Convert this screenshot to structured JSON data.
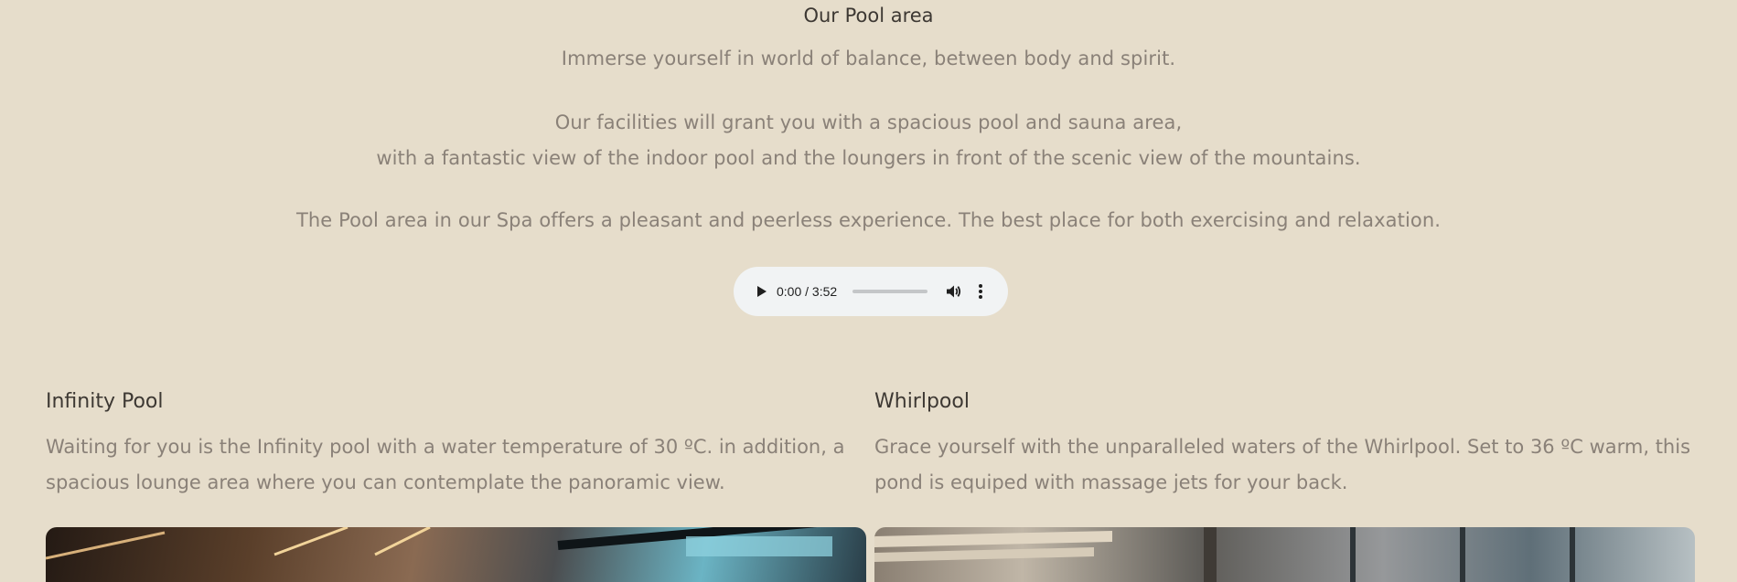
{
  "intro": {
    "title": "Our Pool area",
    "paragraph_1": "Immerse yourself in world of balance, between body and spirit.",
    "paragraph_2_line_1": "Our facilities will grant you with a spacious pool and sauna area,",
    "paragraph_2_line_2": "with a fantastic view of the indoor pool and the loungers in front of the scenic view of the mountains.",
    "paragraph_3": "The Pool area in our Spa offers a pleasant and peerless experience. The best place for both exercising and relaxation."
  },
  "audio": {
    "current_time": "0:00",
    "duration": "3:52",
    "time_label": "0:00 / 3:52",
    "progress": 0,
    "icons": {
      "play": "play-icon",
      "volume": "volume-icon",
      "more": "more-options-icon"
    }
  },
  "sections": [
    {
      "title": "Infinity Pool",
      "description": "Waiting for you is the Infinity pool with a water temperature of 30 ºC. in addition, a spacious lounge area where you can contemplate the panoramic view."
    },
    {
      "title": "Whirlpool",
      "description": "Grace yourself with the unparalleled waters of the Whirlpool. Set to 36 ºC warm, this pond is equiped with massage jets for your back."
    }
  ],
  "colors": {
    "background": "#e6ddcb",
    "heading": "#3d3833",
    "body_text": "#8a8178",
    "audio_player_bg": "#f1f3f4"
  }
}
